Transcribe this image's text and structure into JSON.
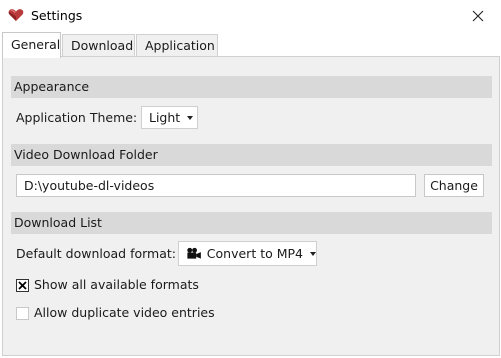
{
  "window": {
    "title": "Settings",
    "app_icon": "heart-logo-icon",
    "close_icon": "close-icon"
  },
  "tabs": [
    {
      "label": "General",
      "active": true
    },
    {
      "label": "Download",
      "active": false
    },
    {
      "label": "Application",
      "active": false
    }
  ],
  "appearance": {
    "header": "Appearance",
    "theme_label": "Application Theme:",
    "theme_value": "Light"
  },
  "folder": {
    "header": "Video Download Folder",
    "path": "D:\\youtube-dl-videos",
    "change_label": "Change"
  },
  "download_list": {
    "header": "Download List",
    "format_label": "Default download format:",
    "format_value": "Convert to MP4",
    "format_icon": "video-camera-icon",
    "show_all_label": "Show all available formats",
    "show_all_checked": true,
    "allow_duplicates_label": "Allow duplicate video entries",
    "allow_duplicates_checked": false
  },
  "colors": {
    "accent": "#c0392b",
    "section_header": "#d9d9d9",
    "panel_bg": "#f0f0f0"
  }
}
